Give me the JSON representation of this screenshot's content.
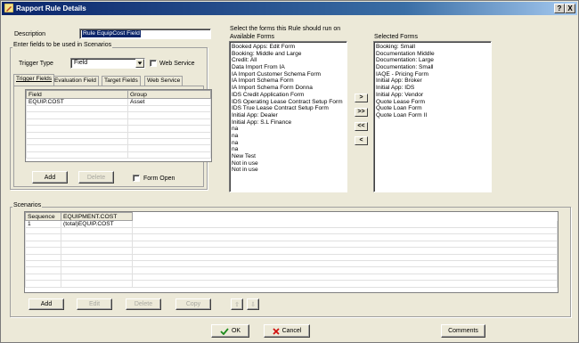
{
  "window": {
    "title": "Rapport Rule Details",
    "help_btn": "?",
    "close_btn": "X"
  },
  "description": {
    "label": "Description",
    "value": "Rule EquipCost Field"
  },
  "scenario_fields": {
    "caption": "Enter fields to be used in Scenarios",
    "trigger_type_label": "Trigger Type",
    "trigger_type_value": "Field",
    "web_service_label": "Web Service"
  },
  "tabs": [
    "Trigger Fields",
    "Evaluation Field",
    "Target Fields",
    "Web Service"
  ],
  "trigger_grid": {
    "headers": [
      "Field",
      "Group"
    ],
    "rows": [
      [
        "EQUIP.COST",
        "Asset"
      ]
    ]
  },
  "trigger_buttons": {
    "add": "Add",
    "delete": "Delete",
    "form_open_label": "Form Open"
  },
  "forms": {
    "caption": "Select the forms this Rule should run on",
    "available_label": "Available Forms",
    "selected_label": "Selected Forms",
    "available": [
      "Booked Apps: Edit Form",
      "Booking: Middle and Large",
      "Credit: All",
      "Data Import From IA",
      "IA Import Customer Schema Form",
      "IA Import Schema Form",
      "IA Import Schema Form Donna",
      "IDS Credit Application Form",
      "IDS Operating Lease Contract Setup Form",
      "IDS True Lease Contract Setup Form",
      "Initial App: Dealer",
      "Initial App: S.L Finance",
      "na",
      "na",
      "na",
      "na",
      "New Test",
      "Not in use",
      "Not in use"
    ],
    "selected": [
      "Booking: Small",
      "Documentation Middle",
      "Documentation: Large",
      "Documentation: Small",
      "IAQE - Pricing Form",
      "Initial App: Broker",
      "Initial App: IDS",
      "Initial App: Vendor",
      "Quote Lease Form",
      "Quote Loan Form",
      "Quote Loan Form II"
    ],
    "move_buttons": [
      ">",
      ">>",
      "<<",
      "<"
    ]
  },
  "scenarios": {
    "label": "Scenarios",
    "headers": [
      "Sequence",
      "EQUIPMENT.COST"
    ],
    "rows": [
      [
        "1",
        "(total)EQUIP.COST"
      ]
    ],
    "buttons": {
      "add": "Add",
      "edit": "Edit",
      "delete": "Delete",
      "copy": "Copy",
      "up": "⇧",
      "down": "⇩"
    }
  },
  "footer": {
    "ok": "OK",
    "cancel": "Cancel",
    "comments": "Comments"
  },
  "colors": {
    "title_bar": "#0a246a",
    "selection": "#0a246a",
    "ok_check": "#1a8a1a",
    "cancel_x": "#d01010"
  }
}
